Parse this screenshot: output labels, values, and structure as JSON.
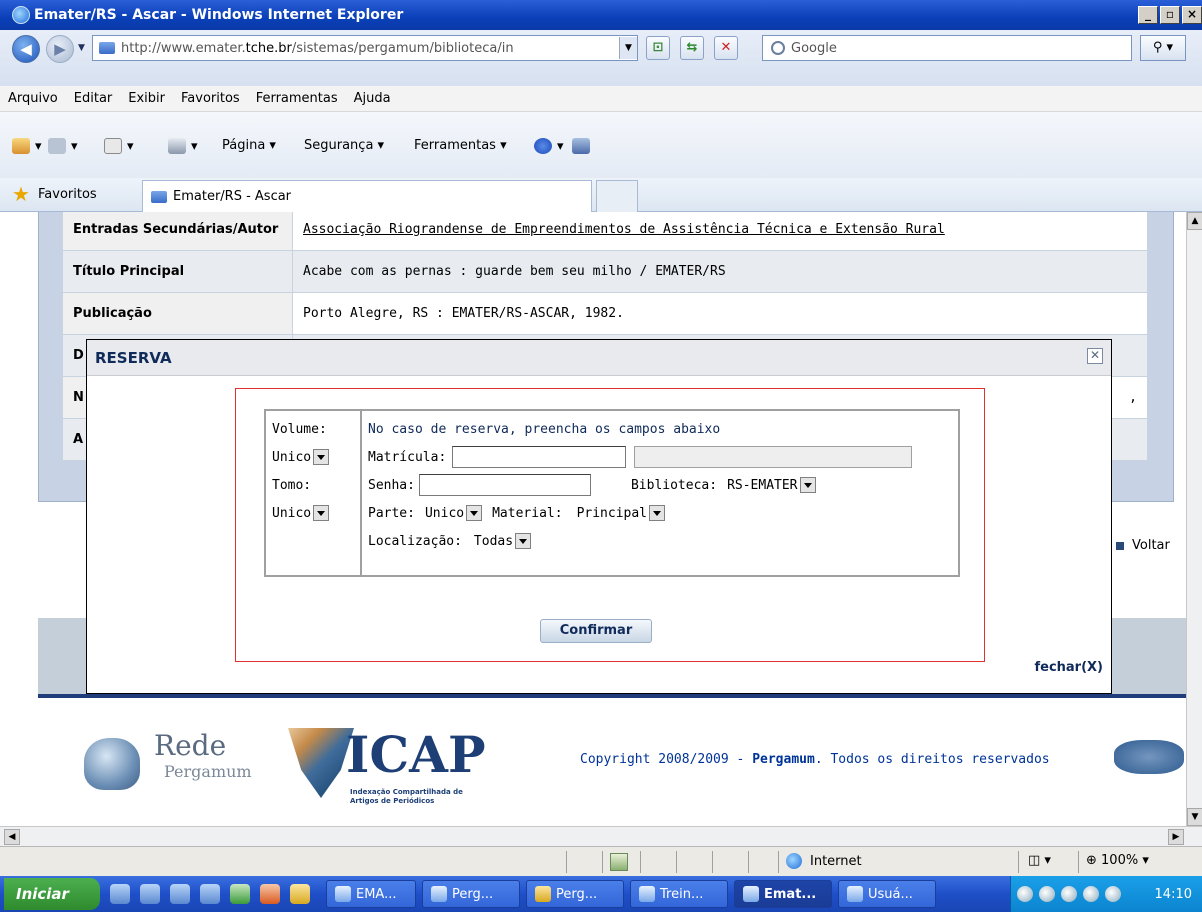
{
  "window": {
    "title": "Emater/RS - Ascar - Windows Internet Explorer"
  },
  "address": {
    "url_prefix": "http://www.emater.",
    "url_domain": "tche.br",
    "url_suffix": "/sistemas/pergamum/biblioteca/in",
    "search_placeholder": "Google"
  },
  "menu": {
    "items": [
      "Arquivo",
      "Editar",
      "Exibir",
      "Favoritos",
      "Ferramentas",
      "Ajuda"
    ]
  },
  "commandbar": {
    "pagina": "Página",
    "seguranca": "Segurança",
    "ferramentas": "Ferramentas"
  },
  "favorites": {
    "label": "Favoritos",
    "tab_title": "Emater/RS - Ascar"
  },
  "record": {
    "rows": [
      {
        "label": "Entradas Secundárias/Autor",
        "value": "Associação Riograndense de Empreendimentos de Assistência Técnica e Extensão Rural"
      },
      {
        "label": "Título Principal",
        "value": "Acabe com as pernas : guarde bem seu milho / EMATER/RS"
      },
      {
        "label": "Publicação",
        "value": "Porto Alegre, RS : EMATER/RS-ASCAR, 1982."
      },
      {
        "label": "D",
        "value": ""
      },
      {
        "label": "N",
        "value": ","
      },
      {
        "label": "A",
        "value": ""
      }
    ]
  },
  "voltar": "Voltar",
  "footer": {
    "rede": "Rede",
    "rede_sub": "Pergamum",
    "icap": "ICAP",
    "icap_sub": "Indexação Compartilhada de Artigos de Periódicos",
    "copyright_prefix": "Copyright 2008/2009 - ",
    "copyright_brand": "Pergamum",
    "copyright_suffix": ". Todos os direitos reservados"
  },
  "modal": {
    "title": "RESERVA",
    "volume_label": "Volume:",
    "volume_value": "Unico",
    "tomo_label": "Tomo:",
    "tomo_value": "Unico",
    "instructions": "No caso de reserva, preencha os campos abaixo",
    "matricula_label": "Matrícula:",
    "senha_label": "Senha:",
    "biblioteca_label": "Biblioteca:",
    "biblioteca_value": "RS-EMATER",
    "parte_label": "Parte:",
    "parte_value": "Unico",
    "material_label": "Material:",
    "material_value": "Principal",
    "localizacao_label": "Localização:",
    "localizacao_value": "Todas",
    "confirm_label": "Confirmar",
    "close_label": "fechar(X)"
  },
  "status": {
    "zone": "Internet",
    "zoom": "100%"
  },
  "taskbar": {
    "start": "Iniciar",
    "items": [
      "EMA...",
      "Perg...",
      "Perg...",
      "Trein...",
      "Emat...",
      "Usuá..."
    ],
    "clock": "14:10"
  }
}
